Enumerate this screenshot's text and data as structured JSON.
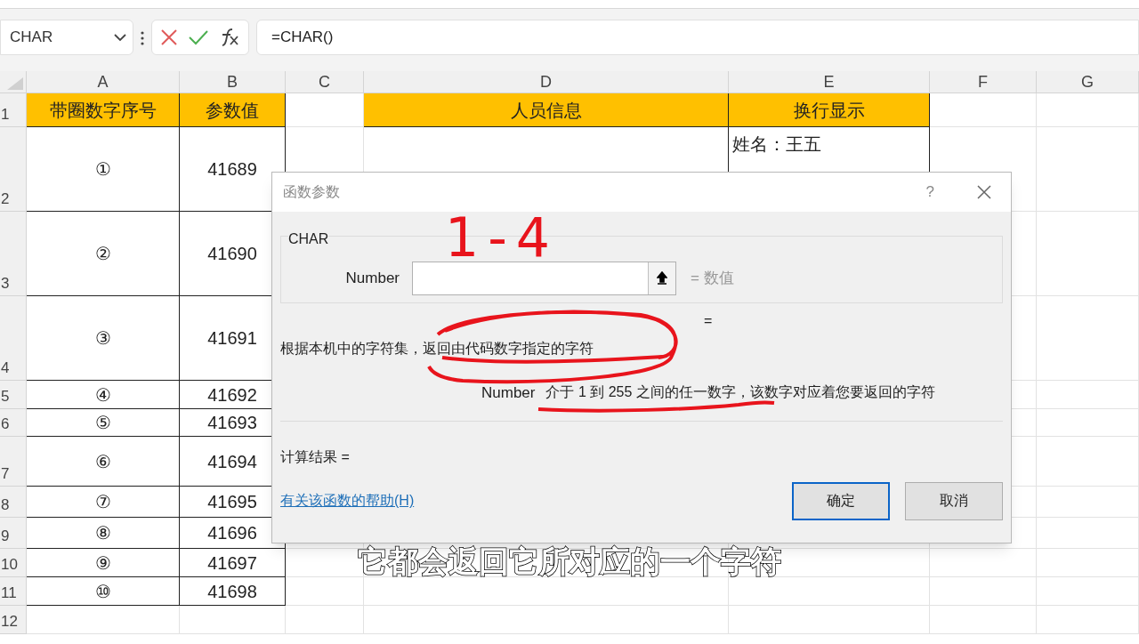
{
  "formula_bar": {
    "name_box": "CHAR",
    "formula": "=CHAR()"
  },
  "sheet": {
    "columns": [
      "A",
      "B",
      "C",
      "D",
      "E",
      "F",
      "G"
    ],
    "rows": [
      {
        "number": "1",
        "kind": "header",
        "a": "带圈数字序号",
        "b": "参数值",
        "d": "人员信息",
        "e": [
          "换行显示"
        ]
      },
      {
        "number": "2",
        "kind": "data",
        "a": "①",
        "b": "41689",
        "e": [
          "姓名：王五"
        ]
      },
      {
        "number": "3",
        "kind": "data",
        "a": "②",
        "b": "41690"
      },
      {
        "number": "4",
        "kind": "data",
        "a": "③",
        "b": "41691"
      },
      {
        "number": "5",
        "kind": "data",
        "a": "④",
        "b": "41692"
      },
      {
        "number": "6",
        "kind": "data",
        "a": "⑤",
        "b": "41693"
      },
      {
        "number": "7",
        "kind": "data",
        "a": "⑥",
        "b": "41694"
      },
      {
        "number": "8",
        "kind": "data",
        "a": "⑦",
        "b": "41695"
      },
      {
        "number": "9",
        "kind": "data",
        "a": "⑧",
        "b": "41696"
      },
      {
        "number": "10",
        "kind": "data",
        "a": "⑨",
        "b": "41697"
      },
      {
        "number": "11",
        "kind": "data",
        "a": "⑩",
        "b": "41698"
      },
      {
        "number": "12",
        "kind": "empty"
      }
    ]
  },
  "dialog": {
    "title": "函数参数",
    "help": "?",
    "group": "CHAR",
    "arg_label": "Number",
    "arg_value": "= 数值",
    "equals": "=",
    "description": "根据本机中的字符集，返回由代码数字指定的字符",
    "arg_help_label": "Number",
    "arg_help": "介于 1 到 255 之间的任一数字，该数字对应着您要返回的字符",
    "result": "计算结果 =",
    "help_link": "有关该函数的帮助(H)",
    "buttons": [
      {
        "label": "确定",
        "default": true
      },
      {
        "label": "取消",
        "default": false
      }
    ]
  },
  "annotation": {
    "handwriting": "1-4"
  },
  "subtitle": "它都会返回它所对应的一个字符"
}
